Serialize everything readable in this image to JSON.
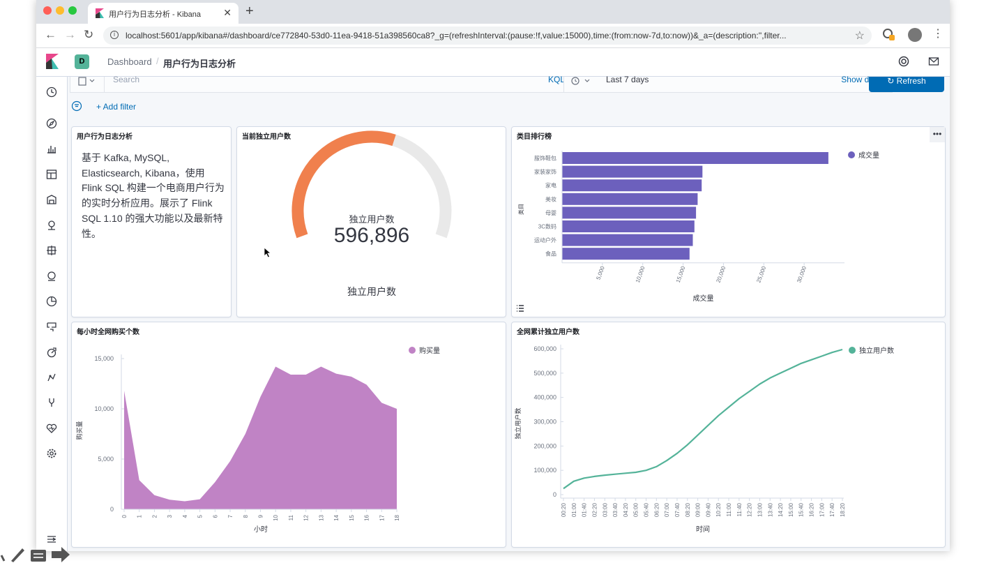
{
  "browser": {
    "tab_title": "用户行为日志分析 - Kibana",
    "url": "localhost:5601/app/kibana#/dashboard/ce772840-53d0-11ea-9418-51a398560ca8?_g=(refreshInterval:(pause:!f,value:15000),time:(from:now-7d,to:now))&_a=(description:'',filter..."
  },
  "header": {
    "space_initial": "D",
    "breadcrumb_root": "Dashboard",
    "breadcrumb_current": "用户行为日志分析"
  },
  "query": {
    "search_placeholder": "Search",
    "kql_label": "KQL",
    "time_range": "Last 7 days",
    "show_dates": "Show dates",
    "refresh_label": "Refresh",
    "add_filter": "+ Add filter"
  },
  "panels": {
    "markdown": {
      "title": "用户行为日志分析",
      "text": "基于 Kafka, MySQL, Elasticsearch, Kibana，使用 Flink SQL 构建一个电商用户行为的实时分析应用。展示了 Flink SQL 1.10 的强大功能以及最新特性。"
    },
    "gauge": {
      "title": "当前独立用户数",
      "label": "独立用户数",
      "value_text": "596,896",
      "footer": "独立用户数",
      "fill_fraction": 0.58,
      "color": "#f0804d"
    },
    "category": {
      "title": "类目排行榜"
    },
    "hourly": {
      "title": "每小时全网购买个数"
    },
    "cumulative": {
      "title": "全网累计独立用户数"
    }
  },
  "chart_data": [
    {
      "type": "bar",
      "orientation": "horizontal",
      "title": "类目排行榜",
      "categories": [
        "服饰鞋包",
        "家装家饰",
        "家电",
        "美妆",
        "母婴",
        "3C数码",
        "运动户外",
        "食品"
      ],
      "series": [
        {
          "name": "成交量",
          "values": [
            33000,
            17400,
            17300,
            16800,
            16600,
            16400,
            16200,
            15800
          ],
          "color": "#6c60bd"
        }
      ],
      "xlabel": "成交量",
      "ylabel": "类目",
      "xticks": [
        5000,
        10000,
        15000,
        20000,
        25000,
        30000
      ],
      "xtick_labels": [
        "5,000",
        "10,000",
        "15,000",
        "20,000",
        "25,000",
        "30,000"
      ],
      "xlim": [
        0,
        35000
      ],
      "legend": "top-right"
    },
    {
      "type": "area",
      "title": "每小时全网购买个数",
      "x": [
        0,
        1,
        2,
        3,
        4,
        5,
        6,
        7,
        8,
        9,
        10,
        11,
        12,
        13,
        14,
        15,
        16,
        17,
        18
      ],
      "series": [
        {
          "name": "购买量",
          "values": [
            11800,
            2900,
            1400,
            950,
            800,
            1000,
            2700,
            4800,
            7500,
            11200,
            14200,
            13400,
            13400,
            14200,
            13500,
            13200,
            12400,
            10600,
            10000
          ],
          "color": "#c083c5"
        }
      ],
      "xlabel": "小时",
      "ylabel": "购买量",
      "ylim": [
        0,
        15000
      ],
      "yticks": [
        0,
        5000,
        10000,
        15000
      ],
      "ytick_labels": [
        "0",
        "5,000",
        "10,000",
        "15,000"
      ],
      "legend": "top-right"
    },
    {
      "type": "line",
      "title": "全网累计独立用户数",
      "x": [
        "00:20",
        "01:00",
        "01:40",
        "02:20",
        "03:00",
        "03:40",
        "04:20",
        "05:00",
        "05:40",
        "06:20",
        "07:00",
        "07:40",
        "08:20",
        "09:00",
        "09:40",
        "10:20",
        "11:00",
        "11:40",
        "12:20",
        "13:00",
        "13:40",
        "14:20",
        "15:00",
        "15:40",
        "16:20",
        "17:00",
        "17:40",
        "18:20"
      ],
      "series": [
        {
          "name": "独立用户数",
          "values": [
            25000,
            55000,
            68000,
            75000,
            80000,
            84000,
            88000,
            92000,
            100000,
            115000,
            140000,
            170000,
            205000,
            245000,
            285000,
            325000,
            360000,
            395000,
            425000,
            455000,
            480000,
            500000,
            520000,
            540000,
            555000,
            570000,
            585000,
            597000
          ],
          "color": "#54b399"
        }
      ],
      "xlabel": "时间",
      "ylabel": "独立用户数",
      "ylim": [
        0,
        600000
      ],
      "yticks": [
        0,
        100000,
        200000,
        300000,
        400000,
        500000,
        600000
      ],
      "ytick_labels": [
        "0",
        "100,000",
        "200,000",
        "300,000",
        "400,000",
        "500,000",
        "600,000"
      ],
      "legend": "top-right"
    }
  ]
}
